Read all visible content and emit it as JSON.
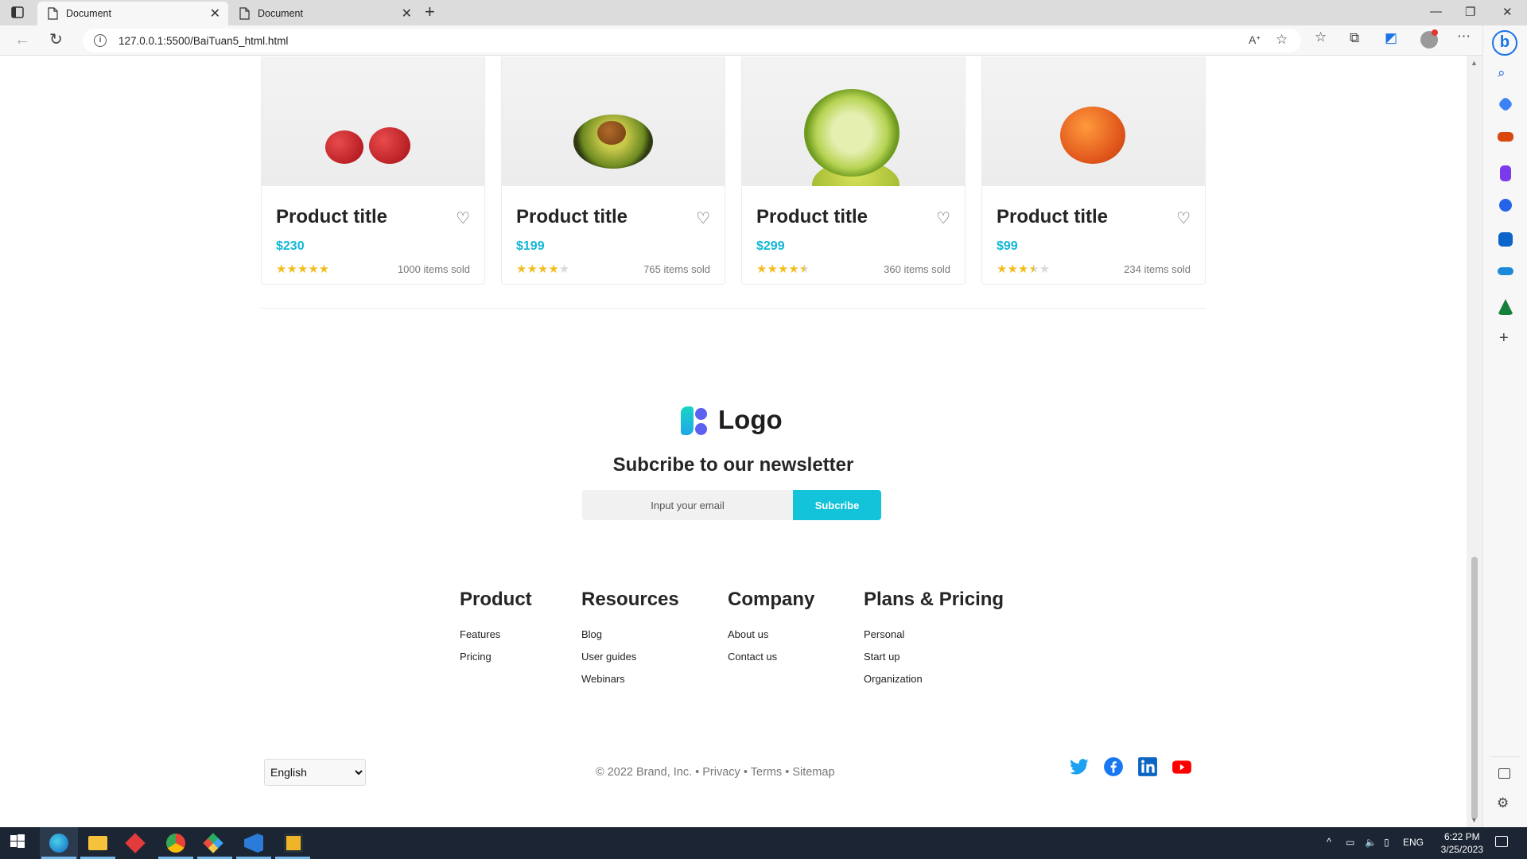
{
  "browser": {
    "tabs": [
      {
        "title": "Document",
        "active": true
      },
      {
        "title": "Document",
        "active": false
      }
    ],
    "url": "127.0.0.1:5500/BaiTuan5_html.html"
  },
  "products": [
    {
      "title": "Product title",
      "price": "$230",
      "rating": 5,
      "sold": "1000 items sold",
      "fruit": "cherries"
    },
    {
      "title": "Product title",
      "price": "$199",
      "rating": 4,
      "sold": "765 items sold",
      "fruit": "avocado"
    },
    {
      "title": "Product title",
      "price": "$299",
      "rating": 4.5,
      "sold": "360 items sold",
      "fruit": "lime"
    },
    {
      "title": "Product title",
      "price": "$99",
      "rating": 3.5,
      "sold": "234 items sold",
      "fruit": "orange"
    }
  ],
  "footer": {
    "logo_text": "Logo",
    "newsletter_title": "Subcribe to our newsletter",
    "email_placeholder": "Input your email",
    "subscribe_label": "Subcribe",
    "columns": [
      {
        "heading": "Product",
        "links": [
          "Features",
          "Pricing"
        ]
      },
      {
        "heading": "Resources",
        "links": [
          "Blog",
          "User guides",
          "Webinars"
        ]
      },
      {
        "heading": "Company",
        "links": [
          "About us",
          "Contact us"
        ]
      },
      {
        "heading": "Plans & Pricing",
        "links": [
          "Personal",
          "Start up",
          "Organization"
        ]
      }
    ],
    "language": "English",
    "copyright": "© 2022 Brand, Inc.",
    "legal_links": [
      "Privacy",
      "Terms",
      "Sitemap"
    ],
    "social": [
      "twitter-icon",
      "facebook-icon",
      "linkedin-icon",
      "youtube-icon"
    ]
  },
  "taskbar": {
    "time": "6:22 PM",
    "date": "3/25/2023",
    "lang": "ENG"
  },
  "colors": {
    "accent": "#12c3da",
    "price": "#12b6d6",
    "star": "#f4bd1f"
  }
}
